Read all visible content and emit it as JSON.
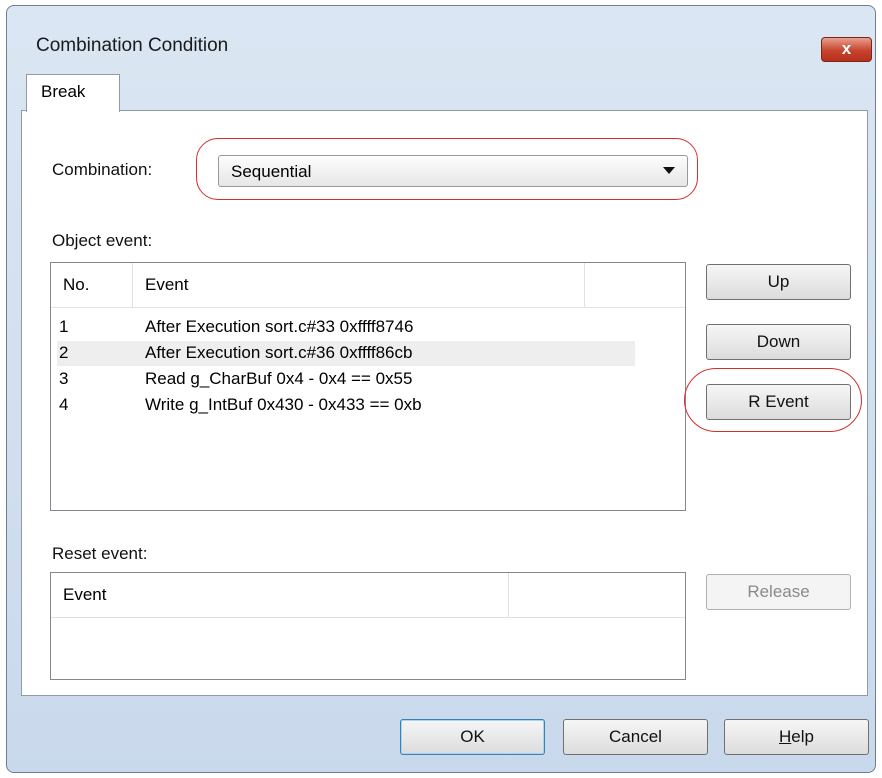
{
  "window": {
    "title": "Combination Condition",
    "close_glyph": "x"
  },
  "tabs": [
    {
      "label": "Break"
    }
  ],
  "combination": {
    "label": "Combination:",
    "value": "Sequential"
  },
  "object_event": {
    "label": "Object event:",
    "columns": [
      "No.",
      "Event"
    ],
    "rows": [
      {
        "no": "1",
        "event": "After Execution sort.c#33 0xffff8746"
      },
      {
        "no": "2",
        "event": "After Execution sort.c#36 0xffff86cb"
      },
      {
        "no": "3",
        "event": "Read g_CharBuf 0x4 - 0x4 == 0x55"
      },
      {
        "no": "4",
        "event": "Write g_IntBuf 0x430 - 0x433 == 0xb"
      }
    ]
  },
  "side_buttons": {
    "up": "Up",
    "down": "Down",
    "r_event": "R Event",
    "release": "Release"
  },
  "reset_event": {
    "label": "Reset event:",
    "columns": [
      "Event"
    ]
  },
  "footer": {
    "ok": "OK",
    "cancel": "Cancel",
    "help_first": "H",
    "help_rest": "elp"
  },
  "colors": {
    "highlight": "#d62d2d",
    "close_button": "#c7442c",
    "dialog_bg": "#d4e1f0"
  },
  "icons": {
    "close": "close-icon",
    "dropdown": "chevron-down-icon"
  }
}
